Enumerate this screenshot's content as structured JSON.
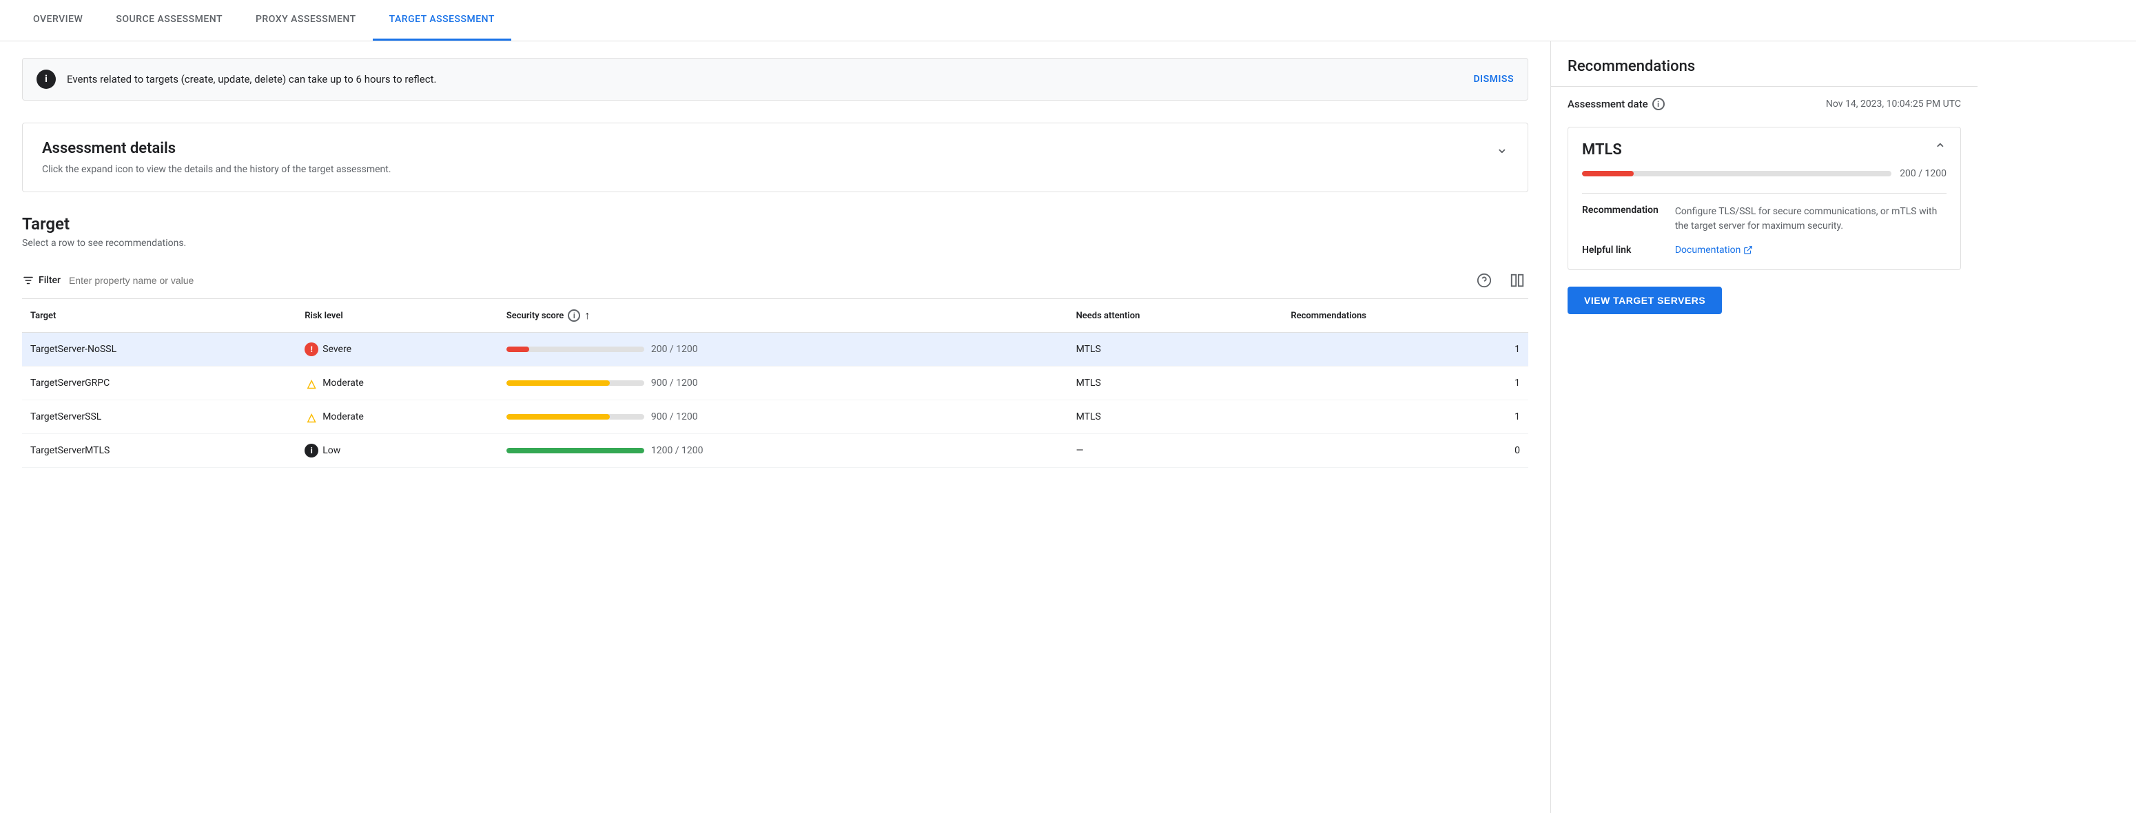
{
  "nav": {
    "tabs": [
      {
        "id": "overview",
        "label": "OVERVIEW",
        "active": false
      },
      {
        "id": "source-assessment",
        "label": "SOURCE ASSESSMENT",
        "active": false
      },
      {
        "id": "proxy-assessment",
        "label": "PROXY ASSESSMENT",
        "active": false
      },
      {
        "id": "target-assessment",
        "label": "TARGET ASSESSMENT",
        "active": true
      }
    ]
  },
  "banner": {
    "icon_label": "i",
    "text": "Events related to targets (create, update, delete) can take up to 6 hours to reflect.",
    "dismiss_label": "DISMISS"
  },
  "assessment_details": {
    "title": "Assessment details",
    "subtitle": "Click the expand icon to view the details and the history of the target assessment."
  },
  "target_section": {
    "title": "Target",
    "subtitle": "Select a row to see recommendations.",
    "filter_label": "Filter",
    "filter_placeholder": "Enter property name or value",
    "columns": [
      {
        "id": "target",
        "label": "Target"
      },
      {
        "id": "risk-level",
        "label": "Risk level"
      },
      {
        "id": "security-score",
        "label": "Security score"
      },
      {
        "id": "needs-attention",
        "label": "Needs attention"
      },
      {
        "id": "recommendations",
        "label": "Recommendations"
      }
    ],
    "rows": [
      {
        "target": "TargetServer-NoSSL",
        "risk_level": "Severe",
        "risk_type": "severe",
        "score_value": 200,
        "score_max": 1200,
        "score_label": "200 / 1200",
        "score_pct": 16.67,
        "score_color": "#ea4335",
        "needs_attention": "MTLS",
        "recommendations": "1",
        "selected": true
      },
      {
        "target": "TargetServerGRPC",
        "risk_level": "Moderate",
        "risk_type": "moderate",
        "score_value": 900,
        "score_max": 1200,
        "score_label": "900 / 1200",
        "score_pct": 75,
        "score_color": "#fbbc04",
        "needs_attention": "MTLS",
        "recommendations": "1",
        "selected": false
      },
      {
        "target": "TargetServerSSL",
        "risk_level": "Moderate",
        "risk_type": "moderate",
        "score_value": 900,
        "score_max": 1200,
        "score_label": "900 / 1200",
        "score_pct": 75,
        "score_color": "#fbbc04",
        "needs_attention": "MTLS",
        "recommendations": "1",
        "selected": false
      },
      {
        "target": "TargetServerMTLS",
        "risk_level": "Low",
        "risk_type": "low",
        "score_value": 1200,
        "score_max": 1200,
        "score_label": "1200 / 1200",
        "score_pct": 100,
        "score_color": "#34a853",
        "needs_attention": "—",
        "recommendations": "0",
        "selected": false
      }
    ]
  },
  "sidebar": {
    "title": "Recommendations",
    "assessment_date_label": "Assessment date",
    "assessment_date_value": "Nov 14, 2023, 10:04:25 PM UTC",
    "mtls": {
      "title": "MTLS",
      "score_label": "200 / 1200",
      "score_pct": 16.67,
      "recommendation_label": "Recommendation",
      "recommendation_value": "Configure TLS/SSL for secure communications, or mTLS with the target server for maximum security.",
      "helpful_link_label": "Helpful link",
      "helpful_link_text": "Documentation",
      "helpful_link_href": "#"
    },
    "view_button_label": "VIEW TARGET SERVERS"
  }
}
